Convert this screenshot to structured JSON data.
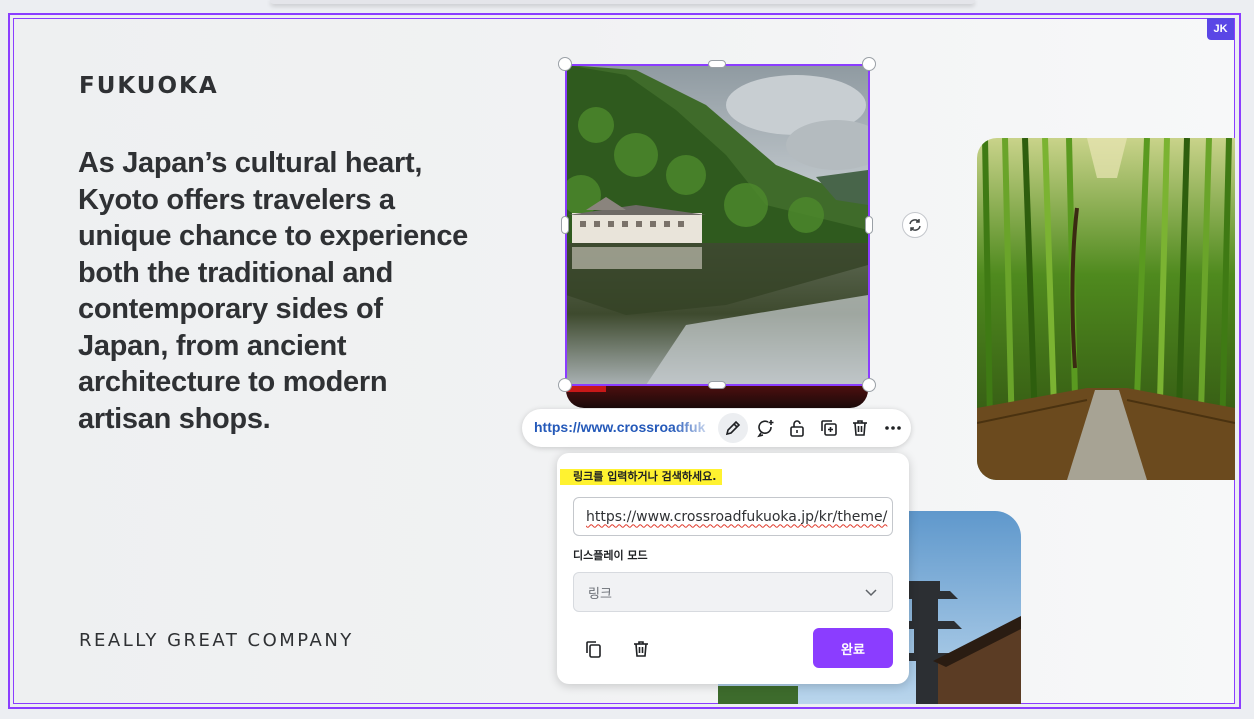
{
  "slide": {
    "city": "FUKUOKA",
    "body": "As Japan’s cultural heart, Kyoto offers travelers a unique chance to experience both the traditional and contemporary sides of Japan, from ancient architecture to modern artisan shops.",
    "company": "REALLY GREAT COMPANY"
  },
  "collaborator": {
    "initials": "JK"
  },
  "link_toolbar": {
    "url": "https://www.crossroadfuk",
    "icons": [
      "pencil-icon",
      "comment-add-icon",
      "lock-open-icon",
      "duplicate-icon",
      "trash-icon",
      "more-icon"
    ]
  },
  "link_popup": {
    "hint": "링크를 입력하거나 검색하세요.",
    "url_value": "https://www.crossroadfukuoka.jp/kr/theme/",
    "display_mode_label": "디스플레이 모드",
    "display_mode_value": "링크",
    "done_label": "완료"
  },
  "colors": {
    "accent": "#8b3dff",
    "link": "#2459b9",
    "highlight": "#fff230",
    "badge": "#5a46e6"
  }
}
